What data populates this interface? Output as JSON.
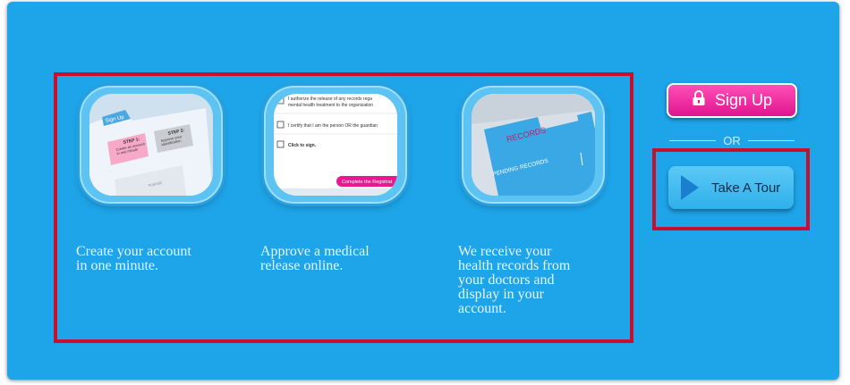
{
  "steps": [
    {
      "caption": "Create your account\nin one minute.",
      "thumb": {
        "tab_label": "Sign Up",
        "step1_title": "STEP 1:",
        "step1_text": "Create an account\nin one minute",
        "step2_title": "STEP 2:",
        "step2_text": "Approve your\nidentification",
        "footer_text": "PLEASE"
      }
    },
    {
      "caption": "Approve a medical\nrelease online.",
      "thumb": {
        "line1": "I authorize the release of any records rega",
        "line2": "mental health treatment to the organization",
        "certify_text": "I certify that I am the person OR the guardian",
        "click_text": "Click to sign.",
        "button_text": "Complete the Registrat"
      }
    },
    {
      "caption": "We receive your\nhealth records from\nyour doctors and\ndisplay in your\naccount.",
      "thumb": {
        "records_label": "RECORDS",
        "pending_label": "PENDING RECORDS"
      }
    }
  ],
  "actions": {
    "signup_label": "Sign Up",
    "or_label": "OR",
    "tour_label": "Take A Tour"
  },
  "colors": {
    "panel": "#1ea4e8",
    "highlight": "#c8102e",
    "signup": "#e0158f"
  }
}
